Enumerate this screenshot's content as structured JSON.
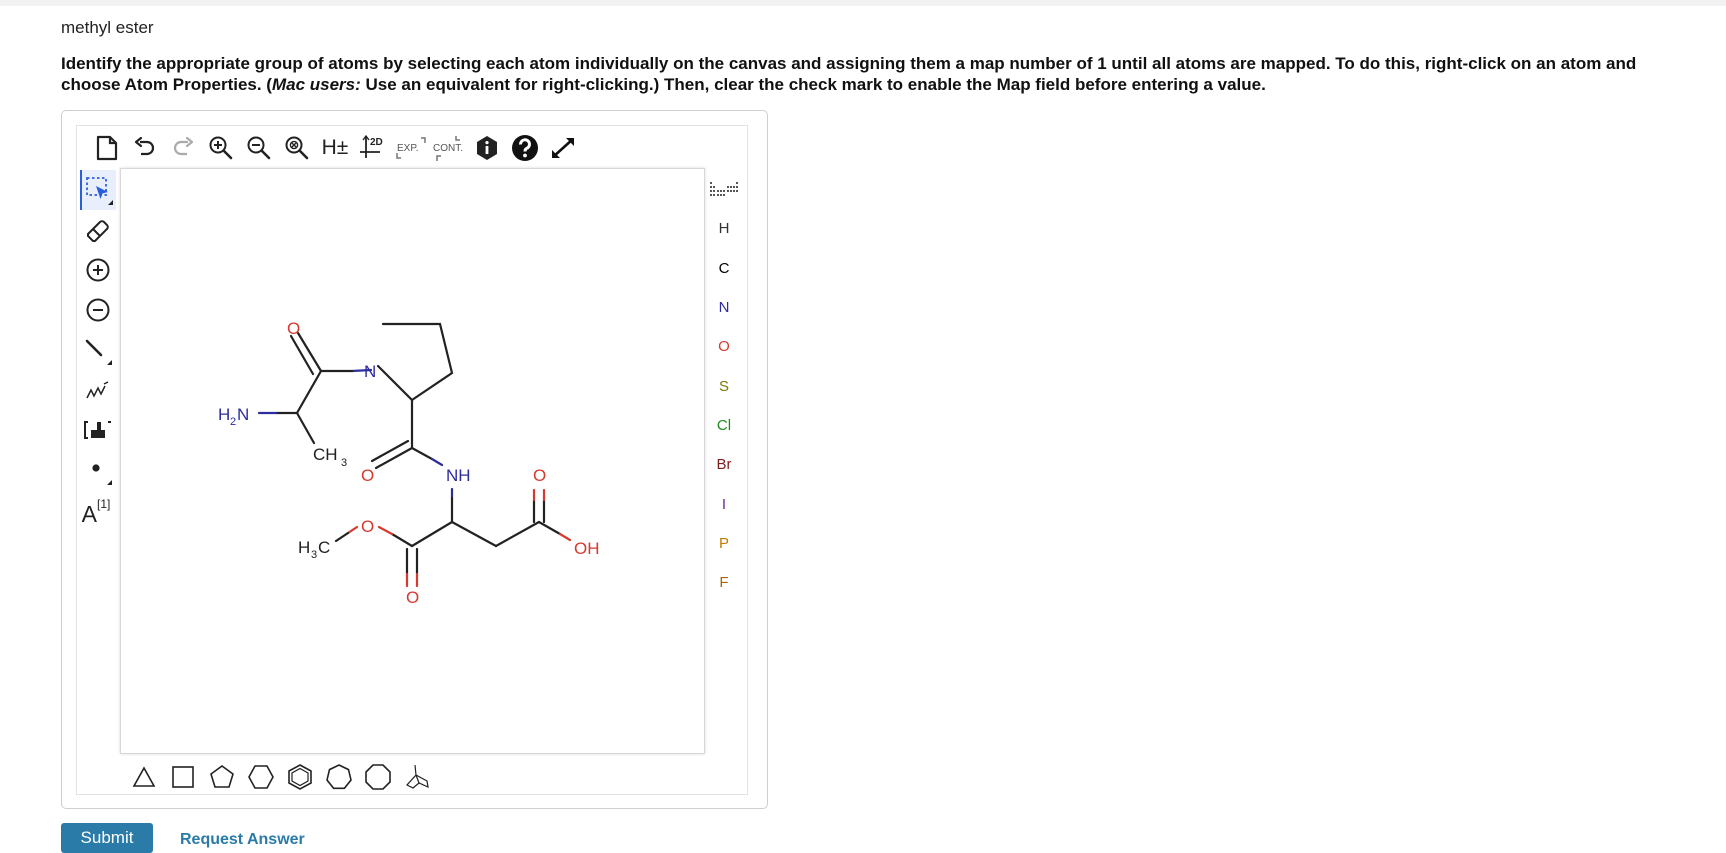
{
  "question": {
    "title": "methyl ester",
    "instruction_part1": "Identify the appropriate group of atoms by selecting each atom individually on the canvas and assigning them a map number of 1 until all atoms are mapped. To do this, right-click on an atom and choose Atom Properties. (",
    "instruction_em": "Mac users:",
    "instruction_part2": " Use an equivalent for right-clicking.) Then, clear the check mark to enable the Map field before entering a value."
  },
  "toolbar": {
    "h_label": "H±",
    "twod_label": "2D",
    "exp_label": "EXP.",
    "cont_label": "CONT."
  },
  "left_tools": {
    "atom_map_label": "A",
    "atom_map_sup": "[1]"
  },
  "elements": [
    {
      "symbol": "H",
      "color": "#333333"
    },
    {
      "symbol": "C",
      "color": "#000000"
    },
    {
      "symbol": "N",
      "color": "#2d2d9e"
    },
    {
      "symbol": "O",
      "color": "#d43a2f"
    },
    {
      "symbol": "S",
      "color": "#7a7a00"
    },
    {
      "symbol": "Cl",
      "color": "#1e8a1e"
    },
    {
      "symbol": "Br",
      "color": "#7a1f1f"
    },
    {
      "symbol": "I",
      "color": "#6a2a9e"
    },
    {
      "symbol": "P",
      "color": "#c47a00"
    },
    {
      "symbol": "F",
      "color": "#a66a00"
    }
  ],
  "molecule": {
    "labels": {
      "n_ring": "N",
      "o_amide1": "O",
      "nh2_main": "H",
      "nh2_sub": "2",
      "nh2_n": "N",
      "ch3_main": "CH",
      "ch3_sub": "3",
      "o_amide2": "O",
      "nh": "NH",
      "o_acid_top": "O",
      "o_ester": "O",
      "h3c_h": "H",
      "h3c_sub": "3",
      "h3c_c": "C",
      "oh": "OH",
      "o_ester_carbonyl": "O"
    }
  },
  "buttons": {
    "submit": "Submit",
    "request_answer": "Request Answer"
  }
}
